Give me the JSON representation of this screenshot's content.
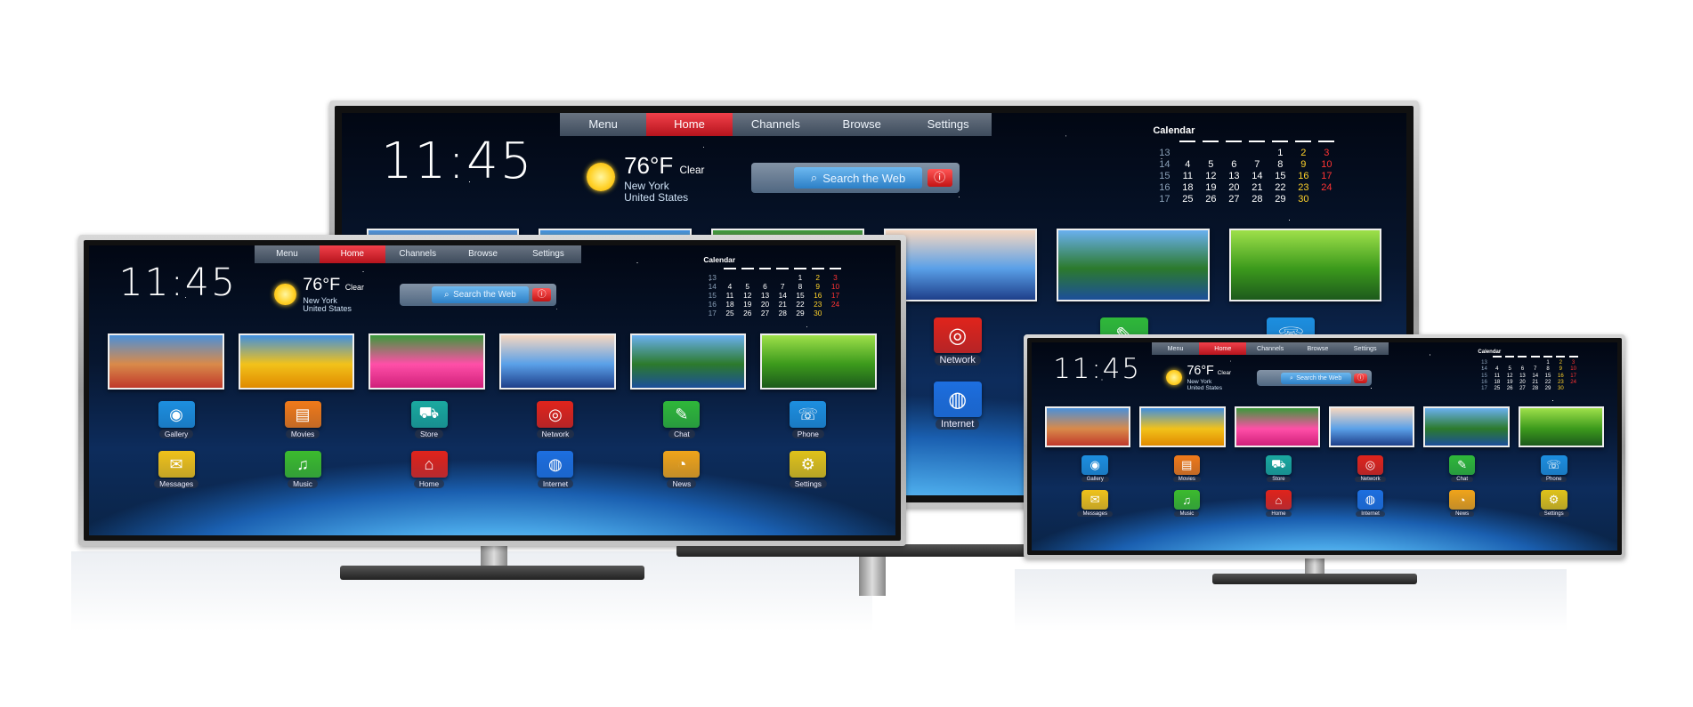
{
  "menu_tabs": [
    {
      "label": "Menu",
      "active": false
    },
    {
      "label": "Home",
      "active": true
    },
    {
      "label": "Channels",
      "active": false
    },
    {
      "label": "Browse",
      "active": false
    },
    {
      "label": "Settings",
      "active": false
    }
  ],
  "clock": "11:45",
  "weather": {
    "temp": "76°F",
    "condition": "Clear",
    "location_line1": "New York",
    "location_line2": "United States"
  },
  "search_placeholder": "Search the Web",
  "calendar": {
    "title": "Calendar",
    "rows": [
      [
        "13",
        "",
        "",
        "",
        "",
        "1",
        "2",
        "3"
      ],
      [
        "14",
        "4",
        "5",
        "6",
        "7",
        "8",
        "9",
        "10"
      ],
      [
        "15",
        "11",
        "12",
        "13",
        "14",
        "15",
        "16",
        "17"
      ],
      [
        "16",
        "18",
        "19",
        "20",
        "21",
        "22",
        "23",
        "24"
      ],
      [
        "17",
        "25",
        "26",
        "27",
        "28",
        "29",
        "30",
        ""
      ]
    ]
  },
  "apps": [
    {
      "label": "Gallery",
      "icon": "camera-icon",
      "color": "#1d8fe0"
    },
    {
      "label": "Movies",
      "icon": "clapper-icon",
      "color": "#f07a1a"
    },
    {
      "label": "Store",
      "icon": "cart-icon",
      "color": "#1aa9a0"
    },
    {
      "label": "Network",
      "icon": "antenna-icon",
      "color": "#e0241c"
    },
    {
      "label": "Chat",
      "icon": "chat-icon",
      "color": "#2fb83a"
    },
    {
      "label": "Phone",
      "icon": "phone-icon",
      "color": "#1d8fe0"
    },
    {
      "label": "Messages",
      "icon": "envelope-icon",
      "color": "#f0c21a"
    },
    {
      "label": "Music",
      "icon": "music-note-icon",
      "color": "#3cbb2e"
    },
    {
      "label": "Home",
      "icon": "house-icon",
      "color": "#e0241c"
    },
    {
      "label": "Internet",
      "icon": "globe-icon",
      "color": "#1d6fe0"
    },
    {
      "label": "News",
      "icon": "rss-icon",
      "color": "#f0a41a"
    },
    {
      "label": "Settings",
      "icon": "gears-icon",
      "color": "#e0c21a"
    }
  ],
  "thumbnails": [
    {
      "name": "city-photo",
      "colors": [
        "#4a90d9",
        "#d98a4a",
        "#c0392b"
      ]
    },
    {
      "name": "sunflowers-photo",
      "colors": [
        "#3f8fe0",
        "#f2c21a",
        "#e08a00"
      ]
    },
    {
      "name": "tulips-photo",
      "colors": [
        "#3a9a3a",
        "#ff4fa8",
        "#d0207a"
      ]
    },
    {
      "name": "mountains-photo",
      "colors": [
        "#f6d7c0",
        "#5aa0e8",
        "#1e3f8a"
      ]
    },
    {
      "name": "lake-photo",
      "colors": [
        "#6ab0f0",
        "#2c7a2c",
        "#1c4f9a"
      ]
    },
    {
      "name": "dragonfly-photo",
      "colors": [
        "#9ee04a",
        "#3c9a1c",
        "#1d5a1c"
      ]
    }
  ],
  "glyphs": {
    "camera-icon": "◉",
    "clapper-icon": "▤",
    "cart-icon": "⛟",
    "antenna-icon": "◎",
    "chat-icon": "✎",
    "phone-icon": "☏",
    "envelope-icon": "✉",
    "music-note-icon": "♫",
    "house-icon": "⌂",
    "globe-icon": "◍",
    "rss-icon": "◔",
    "gears-icon": "⚙",
    "search-icon": "⌕",
    "info-icon": "ⓘ"
  },
  "network_label": "Network",
  "internet_label": "Internet"
}
